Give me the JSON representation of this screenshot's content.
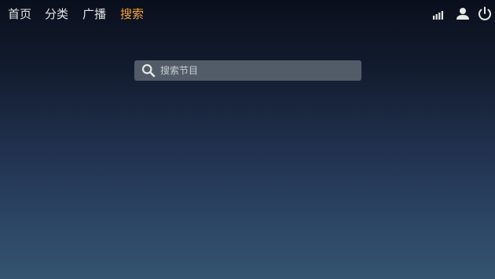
{
  "nav": {
    "tabs": [
      {
        "label": "首页",
        "active": false
      },
      {
        "label": "分类",
        "active": false
      },
      {
        "label": "广播",
        "active": false
      },
      {
        "label": "搜索",
        "active": true
      }
    ]
  },
  "status_icons": [
    "signal-icon",
    "user-icon",
    "power-icon"
  ],
  "search": {
    "placeholder": "搜索节目",
    "value": ""
  },
  "colors": {
    "active_tab": "#f3a33b",
    "tab_text": "#e4e4e4",
    "search_box_bg": "#525c69",
    "background_top": "#0a0f1c",
    "background_bottom": "#34546f"
  }
}
